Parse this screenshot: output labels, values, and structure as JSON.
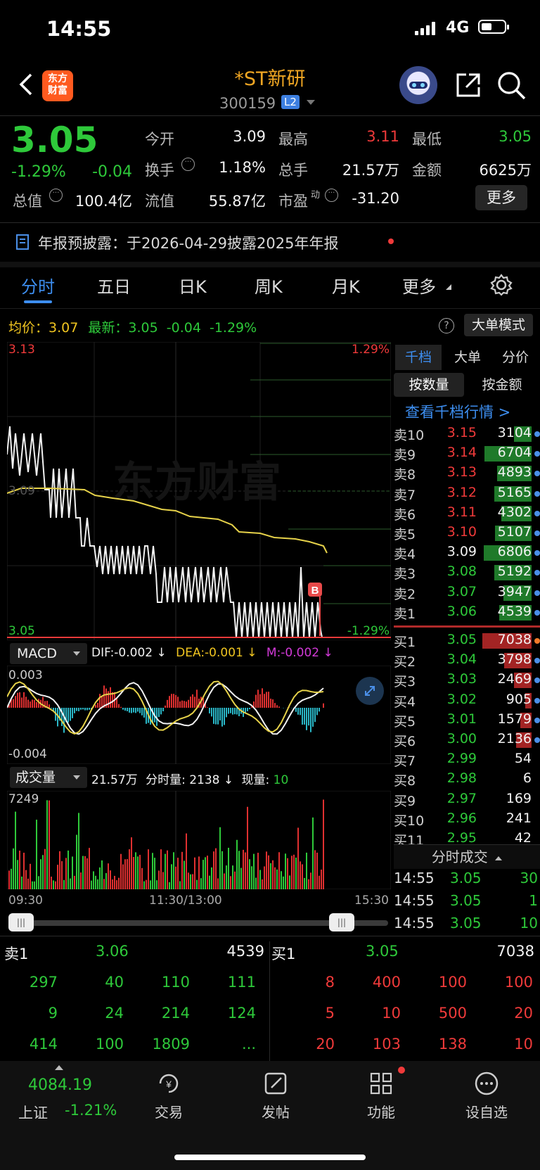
{
  "status_bar": {
    "time": "14:55",
    "network": "4G"
  },
  "header": {
    "name": "*ST新研",
    "code": "300159",
    "level_badge": "L2",
    "logo_line1": "东方",
    "logo_line2": "财富"
  },
  "quote": {
    "price": "3.05",
    "change_pct": "-1.29%",
    "change": "-0.04",
    "open_label": "今开",
    "open": "3.09",
    "high_label": "最高",
    "high": "3.11",
    "low_label": "最低",
    "low": "3.05",
    "turnover_label": "换手",
    "turnover": "1.18%",
    "volume_label": "总手",
    "volume": "21.57万",
    "amount_label": "金额",
    "amount": "6625万",
    "mktcap_label": "总值",
    "mktcap": "100.4亿",
    "float_label": "流值",
    "float": "55.87亿",
    "pe_label": "市盈",
    "pe_sup": "动",
    "pe": "-31.20",
    "more_button": "更多"
  },
  "notice": {
    "text": "年报预披露：于2026-04-29披露2025年年报"
  },
  "tabs": [
    "分时",
    "五日",
    "日K",
    "周K",
    "月K",
    "更多"
  ],
  "chart_header": {
    "avg_label": "均价：",
    "avg": "3.07",
    "latest_label": "最新：",
    "latest": "3.05",
    "change": "-0.04",
    "change_pct": "-1.29%",
    "big_order_button": "大单模式"
  },
  "chart_labels": {
    "y_top": "3.13",
    "y_bottom": "3.05",
    "pct_top": "1.29%",
    "pct_bottom": "-1.29%",
    "y_mid": "3.09",
    "watermark": "东方财富",
    "buy_marker": "B"
  },
  "chart_data": {
    "type": "line",
    "y_range": [
      3.05,
      3.13
    ],
    "x_ticks": [
      "09:30",
      "11:30/13:00",
      "15:30"
    ],
    "series": [
      {
        "name": "均价",
        "values": [
          3.1,
          3.095,
          3.095,
          3.093,
          3.09,
          3.088,
          3.085,
          3.083,
          3.082,
          3.08,
          3.079,
          3.077,
          3.075,
          3.074,
          3.072,
          3.071,
          3.07
        ]
      }
    ]
  },
  "macd": {
    "selector": "MACD",
    "dif": "DIF:-0.002 ↓",
    "dea": "DEA:-0.001 ↓",
    "m": "M:-0.002 ↓",
    "y_top": "0.003",
    "y_bottom": "-0.004"
  },
  "volume_panel": {
    "selector": "成交量",
    "total": "21.57万",
    "minute": "分时量: 2138 ↓",
    "current_label": "现量:",
    "current": "10",
    "y_top": "7249"
  },
  "time_axis": {
    "start": "09:30",
    "mid": "11:30/13:00",
    "end": "15:30"
  },
  "order_book": {
    "tabs": [
      "千档",
      "大单",
      "分价"
    ],
    "sub_tabs": [
      "按数量",
      "按金额"
    ],
    "link": "查看千档行情 >",
    "asks": [
      {
        "label": "卖10",
        "price": "3.15",
        "qty": "3104",
        "fill": 0.35
      },
      {
        "label": "卖9",
        "price": "3.14",
        "qty": "6704",
        "fill": 0.95
      },
      {
        "label": "卖8",
        "price": "3.13",
        "qty": "4893",
        "fill": 0.7
      },
      {
        "label": "卖7",
        "price": "3.12",
        "qty": "5165",
        "fill": 0.75
      },
      {
        "label": "卖6",
        "price": "3.11",
        "qty": "4302",
        "fill": 0.62
      },
      {
        "label": "卖5",
        "price": "3.10",
        "qty": "5107",
        "fill": 0.74
      },
      {
        "label": "卖4",
        "price": "3.09",
        "qty": "6806",
        "fill": 0.97
      },
      {
        "label": "卖3",
        "price": "3.08",
        "qty": "5192",
        "fill": 0.75
      },
      {
        "label": "卖2",
        "price": "3.07",
        "qty": "3947",
        "fill": 0.57
      },
      {
        "label": "卖1",
        "price": "3.06",
        "qty": "4539",
        "fill": 0.66
      }
    ],
    "bids": [
      {
        "label": "买1",
        "price": "3.05",
        "qty": "7038",
        "fill": 1.0
      },
      {
        "label": "买2",
        "price": "3.04",
        "qty": "3798",
        "fill": 0.55
      },
      {
        "label": "买3",
        "price": "3.03",
        "qty": "2469",
        "fill": 0.36
      },
      {
        "label": "买4",
        "price": "3.02",
        "qty": "905",
        "fill": 0.13
      },
      {
        "label": "买5",
        "price": "3.01",
        "qty": "1579",
        "fill": 0.23
      },
      {
        "label": "买6",
        "price": "3.00",
        "qty": "2136",
        "fill": 0.31
      },
      {
        "label": "买7",
        "price": "2.99",
        "qty": "54",
        "fill": 0.0
      },
      {
        "label": "买8",
        "price": "2.98",
        "qty": "6",
        "fill": 0.0
      },
      {
        "label": "买9",
        "price": "2.97",
        "qty": "169",
        "fill": 0.0
      },
      {
        "label": "买10",
        "price": "2.96",
        "qty": "241",
        "fill": 0.0
      },
      {
        "label": "买11",
        "price": "2.95",
        "qty": "42",
        "fill": 0.0
      }
    ]
  },
  "ticks": {
    "title": "分时成交",
    "rows": [
      {
        "time": "14:55",
        "price": "3.05",
        "qty": "30"
      },
      {
        "time": "14:55",
        "price": "3.05",
        "qty": "1"
      },
      {
        "time": "14:55",
        "price": "3.05",
        "qty": "10"
      }
    ]
  },
  "queue": {
    "sell_label": "卖1",
    "sell_price": "3.06",
    "sell_qty": "4539",
    "buy_label": "买1",
    "buy_price": "3.05",
    "buy_qty": "7038",
    "sell_cells": [
      "297",
      "40",
      "110",
      "111",
      "9",
      "24",
      "214",
      "124",
      "414",
      "100",
      "1809",
      "..."
    ],
    "buy_cells": [
      "8",
      "400",
      "100",
      "100",
      "5",
      "10",
      "500",
      "20",
      "20",
      "103",
      "138",
      "10"
    ]
  },
  "bottom_nav": {
    "index_value": "4084.19",
    "index_name": "上证",
    "index_change": "-1.21%",
    "items": [
      "交易",
      "发帖",
      "功能",
      "设自选"
    ]
  },
  "colors": {
    "up": "#f03a3a",
    "down": "#2ec93a",
    "avg_line": "#f0c520",
    "accent": "#3d8ef0",
    "logo": "#ff5a1f"
  }
}
